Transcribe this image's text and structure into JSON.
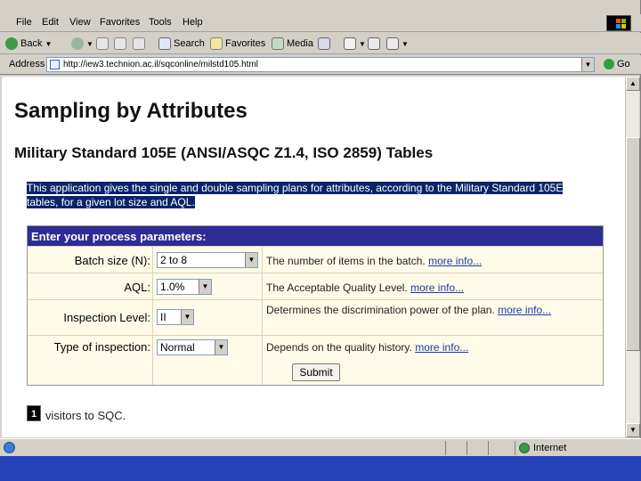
{
  "menubar": {
    "items": [
      "File",
      "Edit",
      "View",
      "Favorites",
      "Tools",
      "Help"
    ]
  },
  "toolbar": {
    "back_label": "Back",
    "search_label": "Search",
    "favorites_label": "Favorites",
    "media_label": "Media"
  },
  "addressbar": {
    "label": "Address",
    "url": "http://iew3.technion.ac.il/sqconline/milstd105.html",
    "go_label": "Go"
  },
  "page": {
    "title": "Sampling by Attributes",
    "subtitle": "Military Standard 105E (ANSI/ASQC Z1.4, ISO 2859) Tables",
    "intro": "This application gives the single and double sampling plans for attributes, according to the Military Standard 105E tables, for a given lot size and AQL."
  },
  "form": {
    "header": "Enter your process parameters:",
    "rows": [
      {
        "label": "Batch size (N):",
        "value": "2 to 8",
        "desc": "The number of items in the batch.",
        "link": "more info..."
      },
      {
        "label": "AQL:",
        "value": "1.0%",
        "desc": "The Acceptable Quality Level.",
        "link": "more info..."
      },
      {
        "label": "Inspection Level:",
        "value": "II",
        "desc": "Determines the discrimination power of the plan.",
        "link": "more info..."
      },
      {
        "label": "Type of inspection:",
        "value": "Normal",
        "desc": "Depends on the quality history.",
        "link": "more info..."
      }
    ],
    "submit_label": "Submit"
  },
  "counter": {
    "badge": "1",
    "text": "visitors to SQC."
  },
  "statusbar": {
    "zone": "Internet"
  }
}
